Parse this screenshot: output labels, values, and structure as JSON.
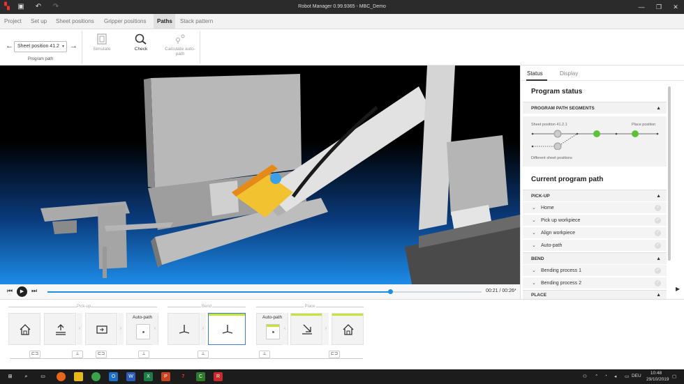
{
  "window": {
    "title": "Robot Manager 0.99.9365 - MBC_Demo"
  },
  "menu": {
    "items": [
      "Project",
      "Set up",
      "Sheet positions",
      "Gripper positions",
      "Paths",
      "Stack pattern"
    ],
    "active": "Paths"
  },
  "toolbar": {
    "selector_value": "Sheet position 41.2",
    "group_label": "Program path",
    "tools": [
      {
        "label": "Simulate",
        "enabled": false
      },
      {
        "label": "Check",
        "enabled": true
      },
      {
        "label": "Calculate auto-path",
        "enabled": false
      }
    ]
  },
  "playback": {
    "time_current": "00:21",
    "time_total": "00:26*",
    "progress": 0.79
  },
  "panel": {
    "tabs": [
      "Status",
      "Display"
    ],
    "active_tab": "Status",
    "program_status_title": "Program status",
    "segments_header": "PROGRAM PATH SEGMENTS",
    "segment_start": "Sheet position 41.2.1",
    "segment_end": "Place position",
    "segment_alt": "Different sheet positions",
    "current_path_title": "Current program path",
    "sections": [
      {
        "name": "PICK-UP",
        "rows": [
          "Home",
          "Pick up workpiece",
          "Align workpiece",
          "Auto-path"
        ]
      },
      {
        "name": "BEND",
        "rows": [
          "Bending process 1",
          "Bending process 2"
        ]
      },
      {
        "name": "PLACE",
        "rows": []
      }
    ]
  },
  "timeline": {
    "groups": [
      "Pick-up",
      "Bend",
      "Place"
    ],
    "autopath_label": "Auto-path",
    "chips": [
      "⊏⊐",
      "⊥",
      "⊏⊐",
      "⊥",
      "⊥",
      "⊥",
      "⊏⊐"
    ]
  },
  "taskbar": {
    "lang": "DEU",
    "time": "10:48",
    "date": "29/10/2019"
  },
  "colors": {
    "accent": "#1a8fe0",
    "lime": "#c6e33b",
    "ok": "#5cc23a"
  },
  "icons": [
    "home-icon",
    "lift-icon",
    "align-icon",
    "bend-icon",
    "place-icon",
    "gripper-icon"
  ]
}
